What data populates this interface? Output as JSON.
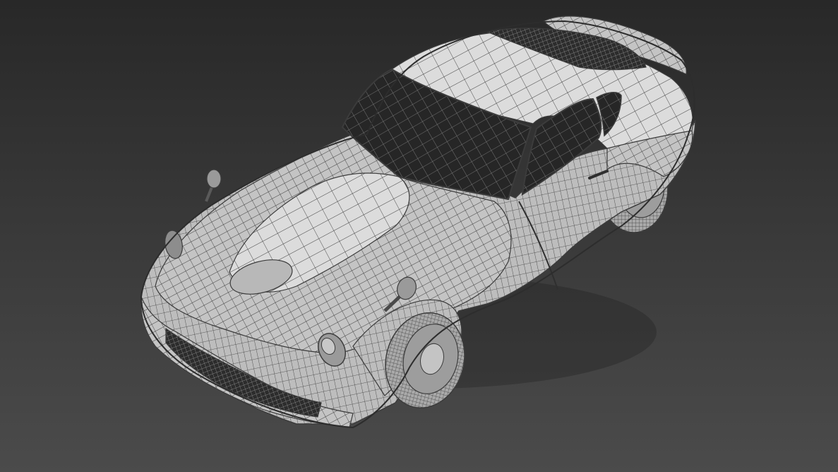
{
  "viewport": {
    "background_top": "#282828",
    "background_bottom": "#4b4b4b"
  },
  "model": {
    "subject": "wireframe-sports-coupe",
    "surface_color": "#c4c4c4",
    "surface_highlight": "#dcdcdc",
    "wire_color": "#3c3c3c",
    "glass_color": "#262626",
    "tire_color": "#a9a9a9"
  }
}
